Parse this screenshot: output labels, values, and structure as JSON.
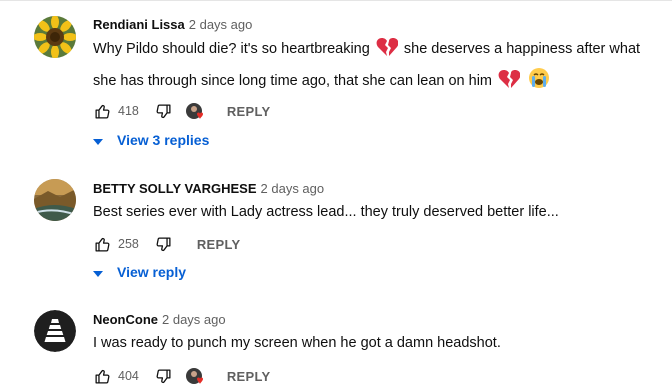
{
  "comments": [
    {
      "author": "Rendiani Lissa",
      "time": "2 days ago",
      "text_line1_a": "Why Pildo should die? it's so heartbreaking",
      "text_line1_b": "she deserves a happiness after what",
      "text_line2": "she has through since long time ago, that she can lean on him",
      "likes": "418",
      "reply_label": "REPLY",
      "view_replies": "View 3 replies",
      "avatar_icon": "sunflower-avatar"
    },
    {
      "author": "BETTY SOLLY VARGHESE",
      "time": "2 days ago",
      "text": "Best series ever with Lady actress lead... they truly deserved better life...",
      "likes": "258",
      "reply_label": "REPLY",
      "view_replies": "View reply",
      "avatar_icon": "landscape-avatar"
    },
    {
      "author": "NeonCone",
      "time": "2 days ago",
      "text": "I was ready to punch my screen when he got a damn headshot.",
      "likes": "404",
      "reply_label": "REPLY",
      "avatar_icon": "cone-logo-avatar"
    }
  ],
  "colors": {
    "link": "#065fd4",
    "muted": "#606060",
    "text": "#0f0f0f",
    "heart": "#e52d27"
  },
  "icons": [
    "thumbs-up-icon",
    "thumbs-down-icon",
    "broken-heart-emoji",
    "crying-face-emoji",
    "creator-heart-icon",
    "caret-down-icon"
  ]
}
